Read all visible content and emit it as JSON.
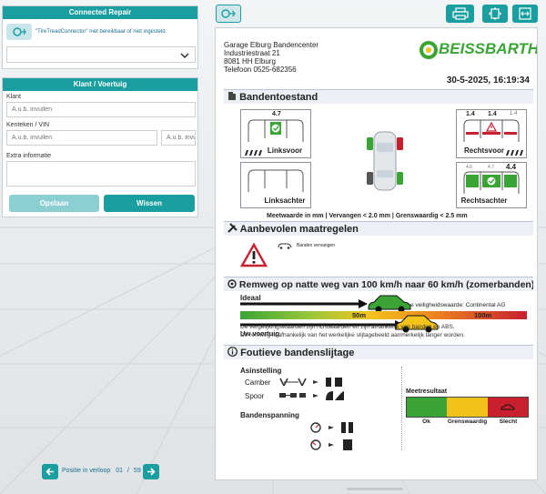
{
  "left_panel": {
    "connected_repair": {
      "title": "Connected Repair",
      "message": "\"TireTreadConnector\" niet bereikbaar of niet ingesteld."
    },
    "klant_voertuig": {
      "title": "Klant / Voertuig",
      "klant_label": "Klant",
      "klant_placeholder": "A.u.b. invullen",
      "kenteken_label": "Kenteken / VIN",
      "kenteken_placeholder": "A.u.b. invullen",
      "vin_placeholder": "A.u.b. invu",
      "extra_label": "Extra informatie",
      "save_label": "Opslaan",
      "clear_label": "Wissen"
    },
    "pager": {
      "label": "Positie in verloop",
      "current": "01",
      "separator": "/",
      "total": "59"
    }
  },
  "report": {
    "garage": {
      "name": "Garage Elburg Bandencenter",
      "street": "Industriestraat 21",
      "city": "8081 HH  Elburg",
      "phone": "Telefoon  0525-682356"
    },
    "logo_text": "BEISSBARTH",
    "datetime": "30-5-2025, 16:19:34",
    "tire_state": {
      "title": "Bandentoestand",
      "front_left": {
        "label": "Linksvoor",
        "value": "4.7"
      },
      "front_right": {
        "label": "Rechtsvoor",
        "values": [
          "1.4",
          "1.4",
          "1.4"
        ]
      },
      "rear_left": {
        "label": "Linksachter"
      },
      "rear_right": {
        "label": "Rechtsachter",
        "values": [
          "4.6",
          "4.7",
          "4.4"
        ]
      },
      "legend": "Meetwaarde in  mm  |  Vervangen < 2.0 mm  |  Grenswaardig < 2.5 mm"
    },
    "recommended": {
      "title": "Aanbevolen maatregelen",
      "item": "Banden vervangen"
    },
    "braking": {
      "title": "Remweg op natte weg van 100 km/h naar 60 km/h (zomerbanden)",
      "ideal_label": "Ideaal",
      "your_label": "Uw voertuig",
      "safety_text": "e veiligheidswaarde: Continental AG",
      "distance_50": "50m",
      "distance_100": "100m",
      "note1": "De vergelijkingswaarden zijn richtwaarden en zijn afhankelijk van banden en ABS.",
      "note2": "De remweg is afhankelijk van het werkelijke slijtagebeeld aanmerkelijk langer worden."
    },
    "wear": {
      "title": "Foutieve bandenslijtage",
      "alignment": "Asinstelling",
      "camber": "Camber",
      "toe": "Spoor",
      "pressure": "Bandenspanning",
      "result_title": "Meetresultaat",
      "ok": "Ok",
      "borderline": "Grenswaardig",
      "bad": "Slecht"
    }
  },
  "colors": {
    "teal": "#1a9ea0",
    "green": "#3aa535",
    "yellow": "#f2c31b",
    "red": "#c8202f"
  },
  "icons": {
    "top_left": "export-icon",
    "print": "printer-icon",
    "zoom_fit": "fit-page-icon",
    "fullscreen": "fullscreen-icon"
  }
}
